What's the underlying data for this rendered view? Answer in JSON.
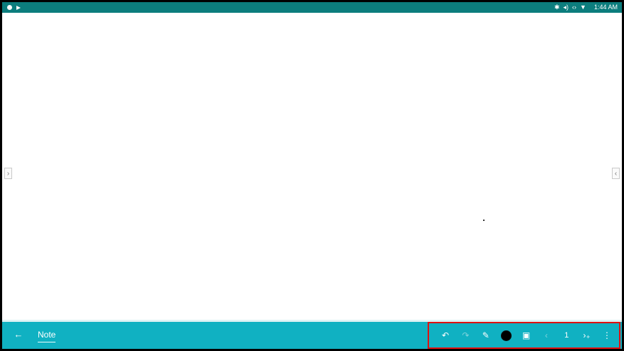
{
  "status_bar": {
    "left_icons": [
      "shield-icon",
      "play-store-icon"
    ],
    "right_icons": [
      "bluetooth-icon",
      "volume-icon",
      "ethernet-icon",
      "wifi-icon"
    ],
    "time": "1:44 AM",
    "background": "#0c7d7d"
  },
  "canvas": {
    "left_handle_icon": "chevron-right-icon",
    "left_handle_glyph": "›",
    "right_handle_icon": "chevron-left-icon",
    "right_handle_glyph": "‹",
    "background": "#ffffff"
  },
  "bottom_bar": {
    "background": "#10b1c2",
    "back_icon": "arrow-left-icon",
    "back_glyph": "←",
    "tab_label": "Note",
    "toolbar": {
      "highlight_color": "#e01010",
      "undo_glyph": "↶",
      "redo_glyph": "↷",
      "pen_glyph": "✎",
      "color_swatch": "#000000",
      "image_glyph": "▣",
      "prev_page_glyph": "‹",
      "page_number": "1",
      "next_page_glyph": "›₊",
      "more_glyph": "⋮"
    }
  }
}
